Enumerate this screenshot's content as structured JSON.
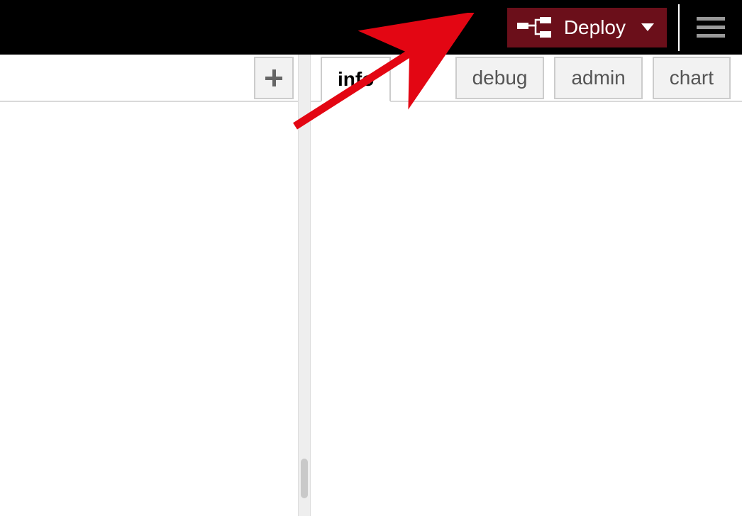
{
  "header": {
    "deploy_label": "Deploy"
  },
  "left": {
    "add_icon": "plus"
  },
  "tabs": {
    "active": "info",
    "items": [
      {
        "id": "info",
        "label": "info"
      },
      {
        "id": "debug",
        "label": "debug"
      },
      {
        "id": "admin",
        "label": "admin"
      },
      {
        "id": "chart",
        "label": "chart"
      }
    ]
  }
}
